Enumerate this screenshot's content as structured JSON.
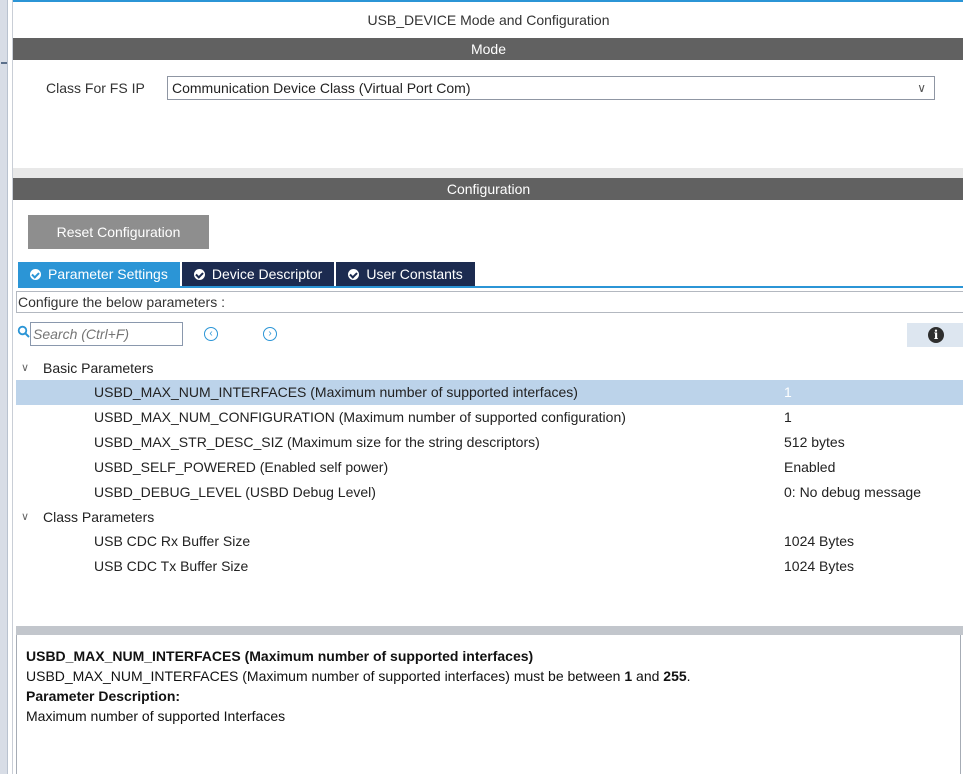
{
  "window": {
    "title": "USB_DEVICE Mode and Configuration"
  },
  "mode": {
    "header": "Mode",
    "class_label": "Class For FS IP",
    "class_value": "Communication Device Class (Virtual Port Com)"
  },
  "configuration": {
    "header": "Configuration",
    "reset_label": "Reset Configuration",
    "tabs": [
      {
        "label": "Parameter Settings",
        "active": true
      },
      {
        "label": "Device Descriptor",
        "active": false
      },
      {
        "label": "User Constants",
        "active": false
      }
    ],
    "configure_text": "Configure the below parameters :",
    "search_placeholder": "Search (Ctrl+F)",
    "info_icon": "i"
  },
  "tree": {
    "basic": {
      "label": "Basic Parameters",
      "params": [
        {
          "name": "USBD_MAX_NUM_INTERFACES (Maximum number of supported interfaces)",
          "value": "1"
        },
        {
          "name": "USBD_MAX_NUM_CONFIGURATION (Maximum number of supported configuration)",
          "value": "1"
        },
        {
          "name": "USBD_MAX_STR_DESC_SIZ (Maximum size for the string descriptors)",
          "value": "512 bytes"
        },
        {
          "name": "USBD_SELF_POWERED (Enabled self power)",
          "value": "Enabled"
        },
        {
          "name": "USBD_DEBUG_LEVEL (USBD Debug Level)",
          "value": "0: No debug message"
        }
      ]
    },
    "class": {
      "label": "Class Parameters",
      "params": [
        {
          "name": "USB CDC Rx Buffer Size",
          "value": "1024 Bytes"
        },
        {
          "name": "USB CDC Tx Buffer Size",
          "value": "1024 Bytes"
        }
      ]
    }
  },
  "description": {
    "title": "USBD_MAX_NUM_INTERFACES (Maximum number of supported interfaces)",
    "range_prefix": "USBD_MAX_NUM_INTERFACES (Maximum number of supported interfaces) must be between ",
    "range_min": "1",
    "range_and": " and ",
    "range_max": "255",
    "range_suffix": ".",
    "param_desc_label": "Parameter Description:",
    "param_desc_text": "Maximum number of supported Interfaces"
  },
  "colors": {
    "accent": "#2b95d6",
    "section_bar": "#616161",
    "inactive_tab": "#1c2b50",
    "selected_row": "#bcd3ea"
  }
}
